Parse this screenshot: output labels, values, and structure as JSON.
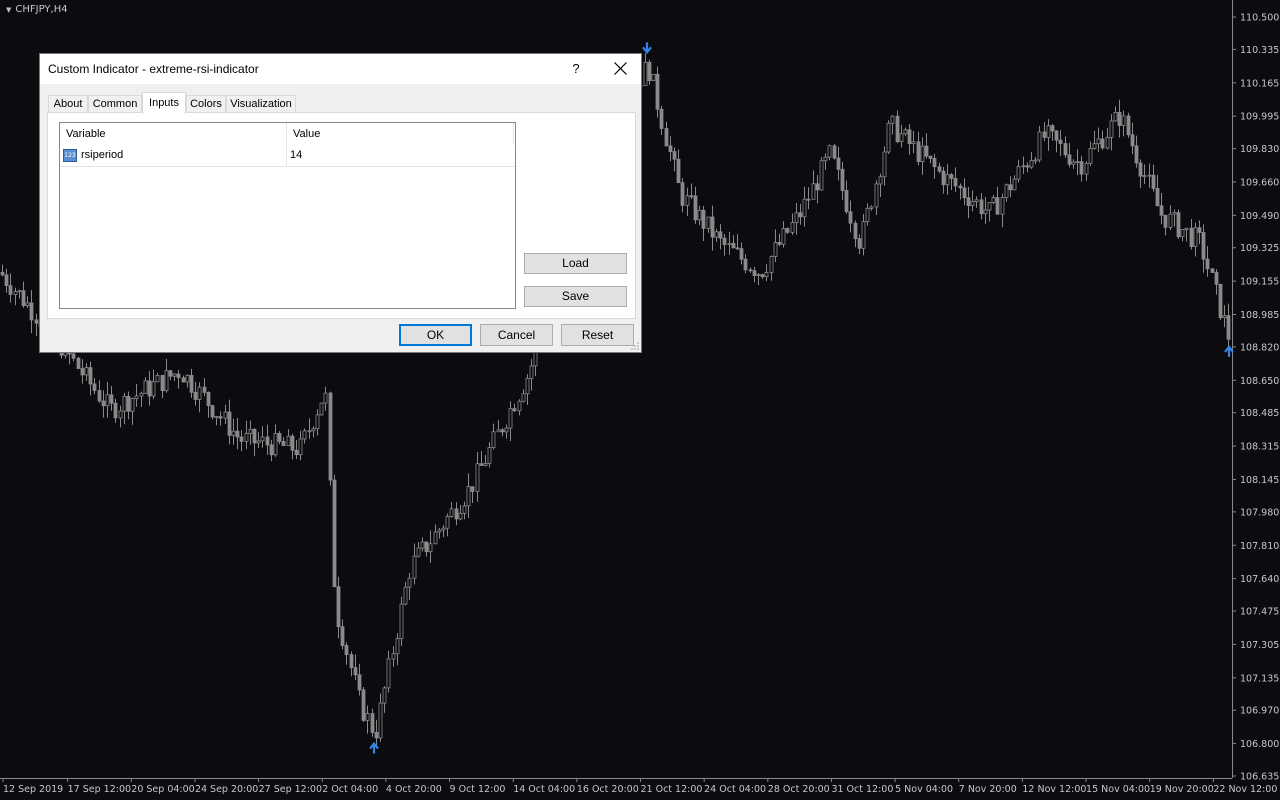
{
  "chart": {
    "symbol": "CHFJPY,H4",
    "background": "#0b0b10",
    "candle_color": "#8a8a8a",
    "arrow_color": "#2f86e8",
    "price_axis": [
      "110.500",
      "110.335",
      "110.165",
      "109.995",
      "109.830",
      "109.660",
      "109.490",
      "109.325",
      "109.155",
      "108.985",
      "108.820",
      "108.650",
      "108.485",
      "108.315",
      "108.145",
      "107.980",
      "107.810",
      "107.640",
      "107.475",
      "107.305",
      "107.135",
      "106.970",
      "106.800",
      "106.635"
    ],
    "time_axis": [
      "12 Sep 2019",
      "17 Sep 12:00",
      "20 Sep 04:00",
      "24 Sep 20:00",
      "27 Sep 12:00",
      "2 Oct 04:00",
      "4 Oct 20:00",
      "9 Oct 12:00",
      "14 Oct 04:00",
      "16 Oct 20:00",
      "21 Oct 12:00",
      "24 Oct 04:00",
      "28 Oct 20:00",
      "31 Oct 12:00",
      "5 Nov 04:00",
      "7 Nov 20:00",
      "12 Nov 12:00",
      "15 Nov 04:00",
      "19 Nov 20:00",
      "22 Nov 12:00"
    ],
    "arrows": [
      {
        "direction": "up",
        "price": 106.8
      },
      {
        "direction": "down",
        "price": 110.32
      },
      {
        "direction": "up",
        "price": 108.82
      }
    ]
  },
  "dialog": {
    "title": "Custom Indicator - extreme-rsi-indicator",
    "help_label": "?",
    "tabs": [
      {
        "label": "About",
        "active": false
      },
      {
        "label": "Common",
        "active": false
      },
      {
        "label": "Inputs",
        "active": true
      },
      {
        "label": "Colors",
        "active": false
      },
      {
        "label": "Visualization",
        "active": false
      }
    ],
    "inputs": {
      "columns": [
        "Variable",
        "Value"
      ],
      "rows": [
        {
          "icon": "integer-param-icon",
          "icon_text": "123",
          "variable": "rsiperiod",
          "value": "14"
        }
      ]
    },
    "load_label": "Load",
    "save_label": "Save",
    "ok_label": "OK",
    "cancel_label": "Cancel",
    "reset_label": "Reset"
  }
}
